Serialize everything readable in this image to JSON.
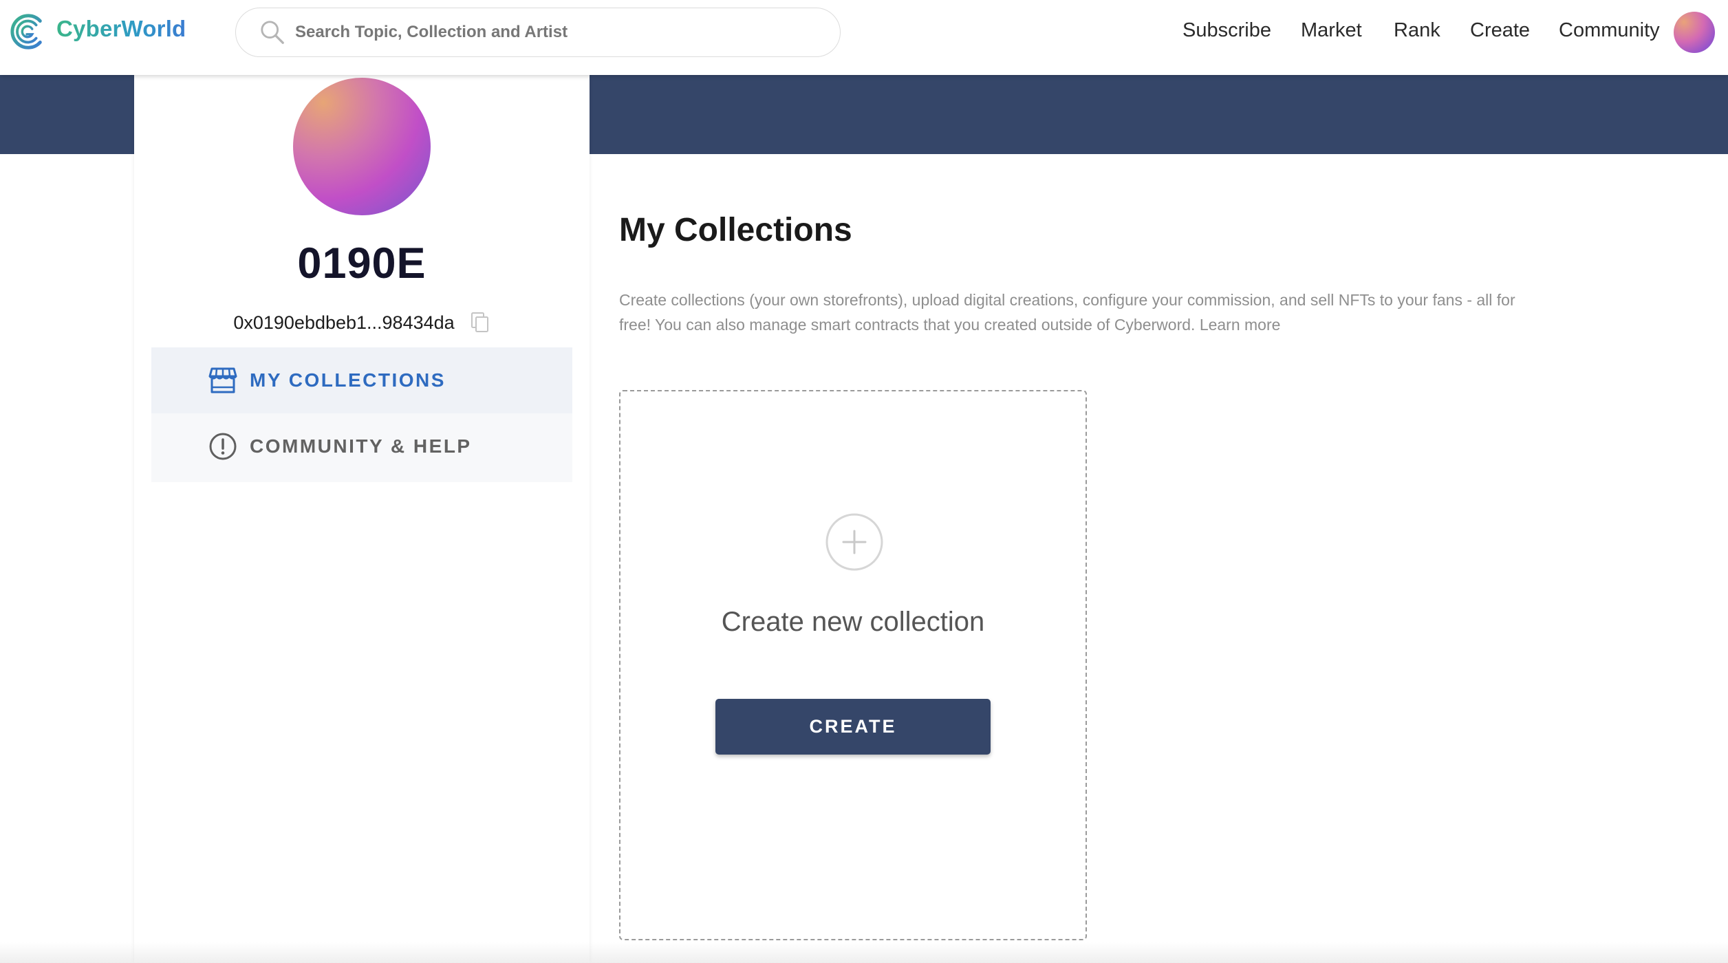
{
  "brand": {
    "name": "CyberWorld",
    "colors": {
      "primary": "#354669",
      "accent": "#2e6bc0",
      "logo_green": "#3bb58a",
      "logo_blue": "#3a7cd1"
    }
  },
  "search": {
    "placeholder": "Search Topic, Collection and Artist",
    "value": ""
  },
  "nav": {
    "items": [
      {
        "label": "Subscribe"
      },
      {
        "label": "Market"
      },
      {
        "label": "Rank"
      },
      {
        "label": "Create"
      },
      {
        "label": "Community"
      }
    ],
    "avatar_icon": "user-avatar"
  },
  "profile": {
    "username": "0190E",
    "wallet_address": "0x0190ebdbeb1...98434da",
    "copy_icon": "copy-icon"
  },
  "sidebar": {
    "items": [
      {
        "label": "MY COLLECTIONS",
        "icon": "storefront-icon",
        "active": true
      },
      {
        "label": "COMMUNITY & HELP",
        "icon": "info-circle-icon",
        "active": false
      }
    ]
  },
  "main": {
    "title": "My Collections",
    "description": "Create collections (your own storefronts), upload digital creations, configure your commission, and sell NFTs to your fans - all for free! You can also manage smart contracts that you created outside of Cyberword.",
    "learn_more": "Learn more",
    "create_card": {
      "icon": "plus-circle-icon",
      "title": "Create new collection",
      "button_label": "CREATE"
    }
  }
}
